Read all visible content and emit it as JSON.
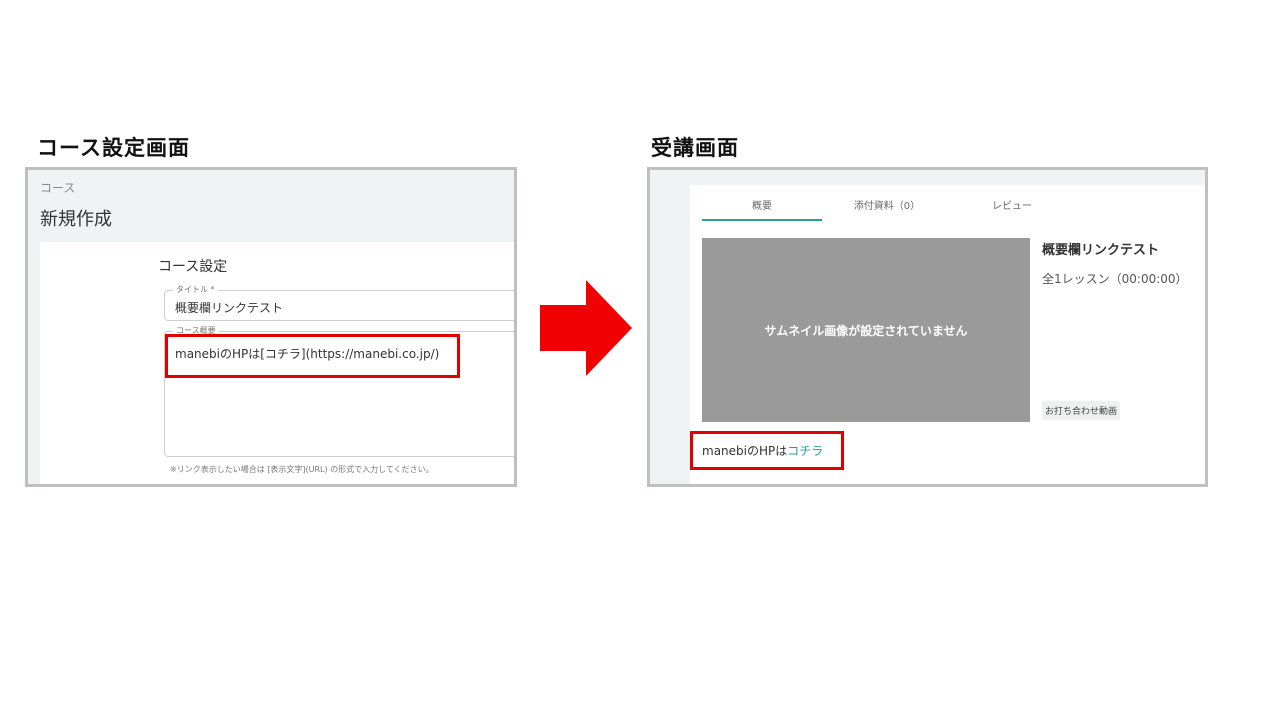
{
  "headings": {
    "left": "コース設定画面",
    "right": "受講画面"
  },
  "left_panel": {
    "breadcrumb": "コース",
    "page_title": "新規作成",
    "section_title": "コース設定",
    "title_field": {
      "label": "タイトル *",
      "value": "概要欄リンクテスト"
    },
    "description_field": {
      "label": "コース概要",
      "value": "manebiのHPは[コチラ](https://manebi.co.jp/)"
    },
    "hint": "※リンク表示したい場合は [表示文字](URL) の形式で入力してください。"
  },
  "right_panel": {
    "tabs": [
      {
        "label": "概要",
        "active": true
      },
      {
        "label": "添付資料（0）",
        "active": false
      },
      {
        "label": "レビュー",
        "active": false
      }
    ],
    "thumbnail_text": "サムネイル画像が設定されていません",
    "course_title": "概要欄リンクテスト",
    "lesson_count": "全1レッスン（00:00:00）",
    "inquiry_button": "お打ち合わせ動画",
    "description_text": "manebiのHPは",
    "description_link": "コチラ"
  },
  "colors": {
    "highlight_box": "#e00000",
    "arrow": "#f00000",
    "accent": "#2a9d96",
    "thumbnail_bg": "#9a9a9a",
    "panel_border": "#bfbfbf"
  },
  "icons": [
    "right-arrow-icon"
  ]
}
